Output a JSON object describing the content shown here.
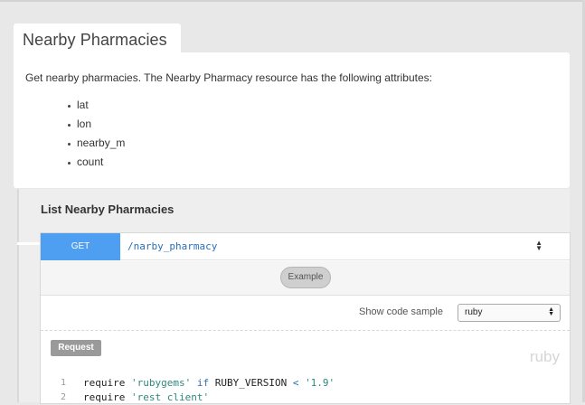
{
  "tab": {
    "title": "Nearby Pharmacies"
  },
  "intro": {
    "description": "Get nearby pharmacies. The Nearby Pharmacy resource has the following attributes:",
    "attributes": [
      "lat",
      "lon",
      "nearby_m",
      "count"
    ]
  },
  "section": {
    "title": "List Nearby Pharmacies"
  },
  "endpoint": {
    "method": "GET",
    "path": "/narby_pharmacy",
    "toggle_icon": "up-down-chevron",
    "example_label": "Example",
    "sample_label": "Show code sample",
    "sample_selected": "ruby",
    "request_label": "Request",
    "language_tag": "ruby"
  },
  "code": {
    "lines": [
      {
        "n": "1",
        "parts": [
          [
            "t",
            "require "
          ],
          [
            "s",
            "'rubygems'"
          ],
          [
            "k",
            " if "
          ],
          [
            "t",
            "RUBY_VERSION "
          ],
          [
            "k",
            "<"
          ],
          [
            "t",
            " "
          ],
          [
            "s",
            "'1.9'"
          ]
        ]
      },
      {
        "n": "2",
        "parts": [
          [
            "t",
            "require "
          ],
          [
            "s",
            "'rest client'"
          ]
        ]
      }
    ]
  },
  "colors": {
    "get_method": "#4e9ef2",
    "path": "#2a6fb6",
    "string": "#2b8a7a"
  }
}
